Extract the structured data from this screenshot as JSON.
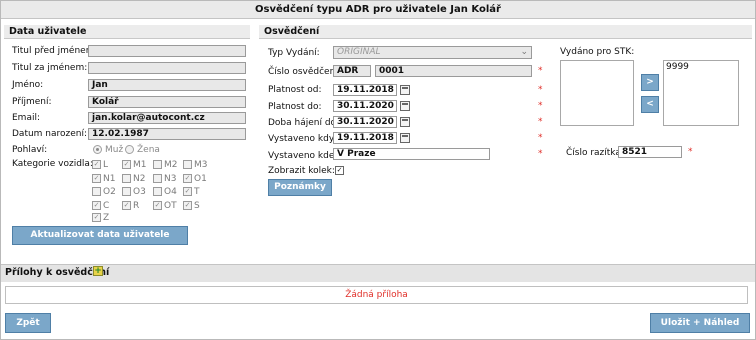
{
  "window": {
    "title": "Osvědčení typu ADR pro uživatele Jan Kolář"
  },
  "user_section": {
    "header": "Data uživatele",
    "fields": [
      {
        "label": "Titul před jménem:",
        "value": ""
      },
      {
        "label": "Titul za jménem:",
        "value": ""
      },
      {
        "label": "Jméno:",
        "value": "Jan"
      },
      {
        "label": "Příjmení:",
        "value": "Kolář"
      },
      {
        "label": "Email:",
        "value": "jan.kolar@autocont.cz"
      },
      {
        "label": "Datum narození:",
        "value": "12.02.1987"
      }
    ],
    "gender_label": "Pohlaví:",
    "gender_options": [
      "Muž",
      "Žena"
    ],
    "categories_label": "Kategorie vozidla:",
    "categories": [
      {
        "name": "L",
        "checked": true
      },
      {
        "name": "M1",
        "checked": true
      },
      {
        "name": "M2",
        "checked": false
      },
      {
        "name": "M3",
        "checked": false
      },
      {
        "name": "N1",
        "checked": true
      },
      {
        "name": "N2",
        "checked": false
      },
      {
        "name": "N3",
        "checked": false
      },
      {
        "name": "O1",
        "checked": true
      },
      {
        "name": "O2",
        "checked": false
      },
      {
        "name": "O3",
        "checked": false
      },
      {
        "name": "O4",
        "checked": false
      },
      {
        "name": "T",
        "checked": true
      },
      {
        "name": "C",
        "checked": true
      },
      {
        "name": "R",
        "checked": true
      },
      {
        "name": "OT",
        "checked": true
      },
      {
        "name": "S",
        "checked": true
      },
      {
        "name": "Z",
        "checked": true
      }
    ],
    "update_button": "Aktualizovat data uživatele"
  },
  "cert_section": {
    "header": "Osvědčení",
    "type_label": "Typ Vydání:",
    "type_value": "ORIGINÁL",
    "number_label": "Číslo osvědčení:",
    "number_prefix": "ADR",
    "number_value": "0001",
    "valid_from_label": "Platnost od:",
    "valid_from": "19.11.2018",
    "valid_to_label": "Platnost do:",
    "valid_to": "30.11.2020",
    "grace_label": "Doba hájení do:",
    "grace": "30.11.2020",
    "issued_when_label": "Vystaveno kdy:",
    "issued_when": "19.11.2018",
    "issued_where_label": "Vystaveno kde:",
    "issued_where": "V Praze",
    "show_stamp_label": "Zobrazit kolek:",
    "notes_button": "Poznámky",
    "required_mark": "*",
    "stk_label": "Vydáno pro STK:",
    "stk_available": "9999",
    "move_right": ">",
    "move_left": "<",
    "stamp_no_label": "Číslo razítka:",
    "stamp_no": "8521"
  },
  "attachments": {
    "header": "Přílohy k osvědčení",
    "empty": "Žádná příloha"
  },
  "footer": {
    "back_button": "Zpět",
    "save_button": "Uložit + Náhled"
  },
  "colors": {
    "button_bg": "#7ba7c9",
    "required": "#e0302a",
    "panel_header": "#ececec"
  }
}
